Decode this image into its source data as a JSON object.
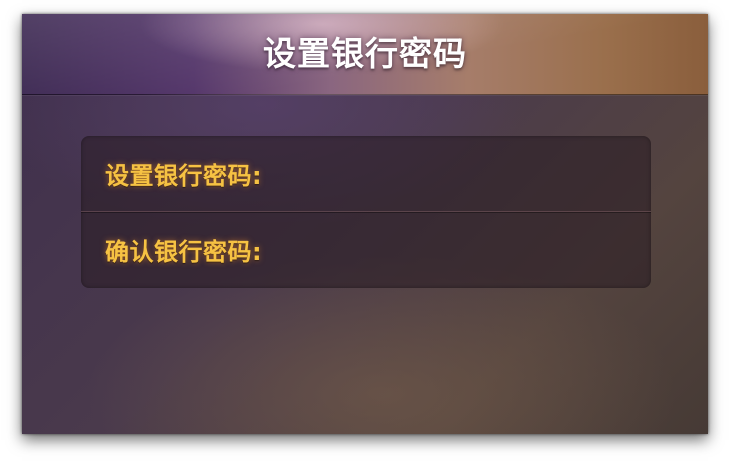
{
  "dialog": {
    "title": "设置银行密码"
  },
  "form": {
    "set_password_label": "设置银行密码:",
    "set_password_value": "",
    "confirm_password_label": "确认银行密码:",
    "confirm_password_value": ""
  },
  "colors": {
    "label": "#f6c243",
    "title": "#ffffff"
  }
}
